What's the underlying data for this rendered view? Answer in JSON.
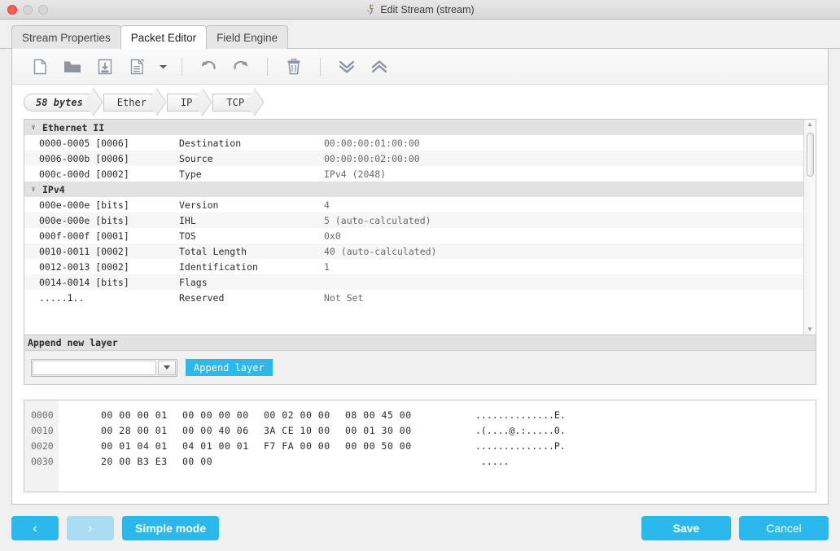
{
  "window": {
    "title": "Edit Stream (stream)",
    "title_icon": "app-icon",
    "controls": {
      "close": "close",
      "minimize": "minimize",
      "maximize": "maximize"
    }
  },
  "colors": {
    "accent_blue": "#2bb8ea",
    "accent_blue_disabled": "#a9dcf1",
    "panel_bg": "#ffffff",
    "window_bg": "#f0f0f0",
    "group_row": "#e2e2e2"
  },
  "tabs": [
    {
      "label": "Stream Properties",
      "active": false
    },
    {
      "label": "Packet Editor",
      "active": true
    },
    {
      "label": "Field Engine",
      "active": false
    }
  ],
  "toolbar": {
    "items": [
      {
        "icon": "new-file-icon",
        "label": "New"
      },
      {
        "icon": "open-folder-icon",
        "label": "Open"
      },
      {
        "icon": "save-disk-icon",
        "label": "Save"
      },
      {
        "icon": "template-document-icon",
        "label": "Template"
      },
      {
        "icon": "chevron-down-icon",
        "label": "Template options"
      },
      {
        "icon": "undo-icon",
        "label": "Undo"
      },
      {
        "icon": "redo-icon",
        "label": "Redo"
      },
      {
        "icon": "trash-icon",
        "label": "Delete"
      },
      {
        "icon": "expand-all-icon",
        "label": "Expand all"
      },
      {
        "icon": "collapse-all-icon",
        "label": "Collapse all"
      }
    ]
  },
  "breadcrumb": [
    {
      "label": "58 bytes",
      "emphasis": true
    },
    {
      "label": "Ether",
      "emphasis": false
    },
    {
      "label": "IP",
      "emphasis": false
    },
    {
      "label": "TCP",
      "emphasis": false
    }
  ],
  "tree": {
    "rows": [
      {
        "kind": "group",
        "twisty": "∨",
        "name": "Ethernet II",
        "offset": "",
        "field": "",
        "value": ""
      },
      {
        "kind": "field",
        "offset": "0000-0005 [0006]",
        "field": "Destination",
        "value": "00:00:00:01:00:00"
      },
      {
        "kind": "field",
        "offset": "0006-000b [0006]",
        "field": "Source",
        "value": "00:00:00:02:00:00"
      },
      {
        "kind": "field",
        "offset": "000c-000d [0002]",
        "field": "Type",
        "value": "IPv4 (2048)"
      },
      {
        "kind": "group",
        "twisty": "∨",
        "name": "IPv4",
        "offset": "",
        "field": "",
        "value": ""
      },
      {
        "kind": "field",
        "offset": "000e-000e [bits]",
        "field": "Version",
        "value": "4"
      },
      {
        "kind": "field",
        "offset": "000e-000e [bits]",
        "field": "IHL",
        "value": "5 (auto-calculated)"
      },
      {
        "kind": "field",
        "offset": "000f-000f [0001]",
        "field": "TOS",
        "value": "0x0"
      },
      {
        "kind": "field",
        "offset": "0010-0011 [0002]",
        "field": "Total Length",
        "value": "40 (auto-calculated)"
      },
      {
        "kind": "field",
        "offset": "0012-0013 [0002]",
        "field": "Identification",
        "value": "1"
      },
      {
        "kind": "field",
        "offset": "0014-0014 [bits]",
        "field": "Flags",
        "value": ""
      },
      {
        "kind": "field",
        "offset": ".....1..",
        "field": "Reserved",
        "value": "Not Set"
      }
    ],
    "scrollbar": {
      "up": "▲",
      "down": "▼"
    }
  },
  "append_layer": {
    "header": "Append new layer",
    "input_value": "",
    "input_placeholder": "",
    "button_label": "Append layer"
  },
  "hexdump": {
    "lines": [
      {
        "offset": "0000",
        "groups": [
          "00 00 00 01",
          "00 00 00 00",
          "00 02 00 00",
          "08 00 45 00"
        ],
        "ascii": "..............E."
      },
      {
        "offset": "0010",
        "groups": [
          "00 28 00 01",
          "00 00 40 06",
          "3A CE 10 00",
          "00 01 30 00"
        ],
        "ascii": ".(....@.:.....0."
      },
      {
        "offset": "0020",
        "groups": [
          "00 01 04 01",
          "04 01 00 01",
          "F7 FA 00 00",
          "00 00 50 00"
        ],
        "ascii": "..............P."
      },
      {
        "offset": "0030",
        "groups": [
          "20 00 B3 E3",
          "00 00",
          "",
          ""
        ],
        "ascii": " ....."
      }
    ]
  },
  "footer": {
    "back_label": "‹",
    "forward_label": "›",
    "forward_disabled": true,
    "simple_mode_label": "Simple mode",
    "save_label": "Save",
    "cancel_label": "Cancel"
  }
}
